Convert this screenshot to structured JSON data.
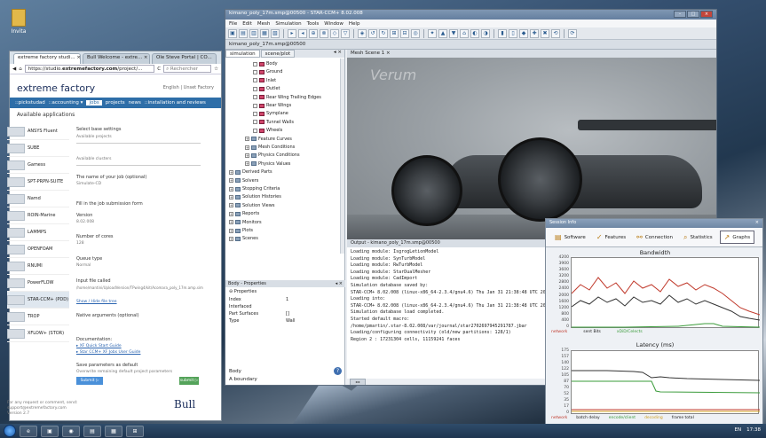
{
  "desktop": {
    "icon_label": "Invita"
  },
  "browser": {
    "tabs": [
      {
        "label": "extreme factory studi... ×"
      },
      {
        "label": "Bull Welcome - extre... ×"
      },
      {
        "label": "Ole Steve Portal | CO..."
      }
    ],
    "url_prefix": "https://studio.",
    "url_domain": "extremefactory.com",
    "url_suffix": "/project/...",
    "search_placeholder": "Rechercher",
    "logo": "extreme factory",
    "logo_right": "English | Unset Factory",
    "nav": [
      "::pickstudad",
      "::accounting ▾",
      "jobs",
      "projects",
      "news",
      "::installation and reviews"
    ],
    "nav_active": "jobs",
    "available_label": "Available applications",
    "apps": [
      "ANSYS Fluent",
      "SUBE",
      "Gamess",
      "SPT-PRPN-SUITE",
      "Namd",
      "ROIN-Marine",
      "LAMMPS",
      "OPENFOAM",
      "RNUMI",
      "PowerFLOW",
      "STAR-CCM+ (PDD)",
      "TROP",
      "XFLOW+ (STOR)"
    ],
    "form": {
      "select_base": "Select base settings",
      "available_projects": "Available projects",
      "available_clusters": "Available clusters",
      "name_job_label": "The name of your job (optional)",
      "name_job_value": "Simulate-CD",
      "fill_form": "Fill in the job submission form",
      "version_label": "Version",
      "version_value": "8.02.008",
      "cores_label": "Number of cores",
      "cores_value": "128",
      "queue_label": "Queue type",
      "queue_value": "Normal",
      "input_label": "Input file called",
      "input_value": "/home/mantini/UploadVersion/TPwing4/kit/Acomara_poly_17m.amp.sim",
      "show_link": "Show / Hide file tree",
      "native_args": "Native arguments (optional)",
      "doc_label": "Documentation:",
      "doc_link1": "▸ XF Quick Start Guide",
      "doc_link2": "▸ Star CCM+ XF Jobs User Guide",
      "save_params": "Save parameters as default",
      "overwrite": "Overwrite remaining default project parameters",
      "submit": "Submit ▷",
      "submit2": "submit ▷",
      "footer": "For any request or comment, send: support@extremefactory.com",
      "footer2": "Version 2.7",
      "brand": "Bull"
    }
  },
  "star": {
    "title": "kimano_poly_17m.smp@00500 - STAR-CCM+ 8.02.008",
    "menu": [
      "File",
      "Edit",
      "Mesh",
      "Simulation",
      "Tools",
      "Window",
      "Help"
    ],
    "doc_tab": "kimano_poly_17m.smp@00500",
    "panel_tabs": [
      "simulation",
      "scene/plot"
    ],
    "panel_close": "◂ ×",
    "tree": [
      {
        "label": "Body",
        "level": 3,
        "part": true
      },
      {
        "label": "Ground",
        "level": 3,
        "part": true
      },
      {
        "label": "Inlet",
        "level": 3,
        "part": true
      },
      {
        "label": "Outlet",
        "level": 3,
        "part": true
      },
      {
        "label": "Rear Wing Trailing Edges",
        "level": 3,
        "part": true
      },
      {
        "label": "Rear Wings",
        "level": 3,
        "part": true
      },
      {
        "label": "Symplane",
        "level": 3,
        "part": true
      },
      {
        "label": "Tunnel Walls",
        "level": 3,
        "part": true
      },
      {
        "label": "Wheels",
        "level": 3,
        "part": true
      },
      {
        "label": "Feature Curves",
        "level": 2,
        "part": false
      },
      {
        "label": "Mesh Conditions",
        "level": 2,
        "part": false
      },
      {
        "label": "Physics Conditions",
        "level": 2,
        "part": false
      },
      {
        "label": "Physics Values",
        "level": 2,
        "part": false
      },
      {
        "label": "Derived Parts",
        "level": 0,
        "part": false
      },
      {
        "label": "Solvers",
        "level": 0,
        "part": false
      },
      {
        "label": "Stopping Criteria",
        "level": 0,
        "part": false
      },
      {
        "label": "Solution Histories",
        "level": 0,
        "part": false
      },
      {
        "label": "Solution Views",
        "level": 0,
        "part": false
      },
      {
        "label": "Reports",
        "level": 0,
        "part": false
      },
      {
        "label": "Monitors",
        "level": 0,
        "part": false
      },
      {
        "label": "Plots",
        "level": 0,
        "part": false
      },
      {
        "label": "Scenes",
        "level": 0,
        "part": false
      }
    ],
    "props_title": "Body - Properties",
    "props_close": "◂ ×",
    "props_header": "Properties",
    "props": [
      {
        "k": "Index",
        "v": "1"
      },
      {
        "k": "Interfaced",
        "v": ""
      },
      {
        "k": "Part Surfaces",
        "v": "[]"
      },
      {
        "k": "Type",
        "v": "Wall"
      }
    ],
    "body_label": "Body",
    "body_desc": "A boundary",
    "help": "?",
    "view_tab": "Mesh Scene 1 ×",
    "watermark": "Verum",
    "output_title": "Output - kimano_poly_17m.smp@00500",
    "output_lines": [
      "Loading module: IsgrogLetionModel",
      "Loading module: SynTurbModel",
      "Loading module: RwTurbModel",
      "Loading module: StarDualMesher",
      "Loading module: CadImport",
      "Simulation database saved by:",
      "  STAR-CCM+ 8.02.008 (linux-x86_64-2.3.4/gnu4.6) Thu Jan 31 21:38:48 UTC 2013",
      "Loading into:",
      "  STAR-CCM+ 8.02.008 (linux-x86_64-2.3.4/gnu4.6) Thu Jan 31 21:38:48 UTC 2013",
      "Simulation database load completed.",
      "Started default macro:",
      "/home/pmartin/.star-8.02.008/var/journal/star2702697945291787.jbar",
      "Loading/configuring connectivity (old/new partitions: 128/1)",
      "  Region 2 : 17231304 cells, 11159241 faces"
    ],
    "out_scroll": "◂ ▸"
  },
  "session": {
    "title": "Session Info",
    "tabs": [
      "Software",
      "Features",
      "Connection",
      "Statistics",
      "Graphs"
    ],
    "active_tab": "Graphs",
    "g1_title": "Bandwidth",
    "g1_yticks": [
      "4200",
      "3900",
      "3600",
      "3200",
      "2800",
      "2400",
      "2000",
      "1600",
      "1200",
      "800",
      "400",
      "0"
    ],
    "g1_legend": [
      "network",
      "sent Bits",
      "xDiD/Celects"
    ],
    "g2_title": "Latency (ms)",
    "g2_yticks": [
      "175",
      "157",
      "140",
      "122",
      "105",
      "87",
      "70",
      "52",
      "35",
      "17",
      "0"
    ],
    "g2_legend": [
      "network",
      "batch delay",
      "encode/client",
      "decoding",
      "frame total"
    ],
    "colors": {
      "network": "#c0392b",
      "sent": "#333333",
      "green": "#3a9b3a"
    }
  },
  "taskbar": {
    "items": [
      "e",
      "▣",
      "◉",
      "▤",
      "▦",
      "⊞"
    ],
    "tray_time": "17:38",
    "tray_lang": "EN"
  }
}
